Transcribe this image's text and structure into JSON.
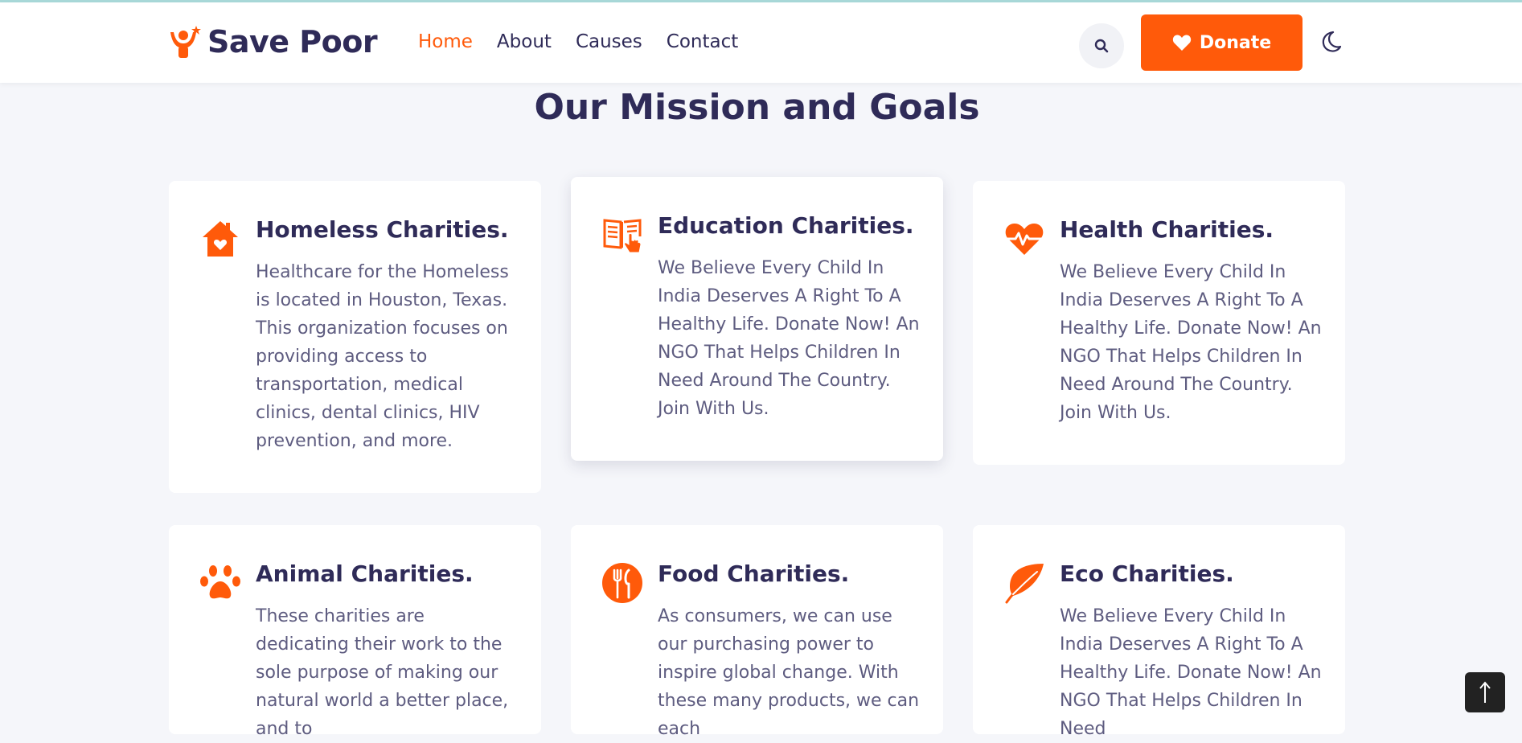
{
  "brand": {
    "name": "Save Poor",
    "accent": "#ff5a0a",
    "dark": "#2f2b58"
  },
  "nav": {
    "items": [
      {
        "label": "Home",
        "active": true
      },
      {
        "label": "About",
        "active": false
      },
      {
        "label": "Causes",
        "active": false
      },
      {
        "label": "Contact",
        "active": false
      }
    ]
  },
  "header": {
    "search_icon": "search-icon",
    "donate_label": "Donate",
    "donate_icon": "heart-icon",
    "theme_icon": "moon-icon"
  },
  "section": {
    "title": "Our Mission and Goals"
  },
  "cards": [
    {
      "title": "Homeless Charities.",
      "icon": "house-heart-icon",
      "text": "Healthcare for the Homeless is located in Houston, Texas. This organization focuses on providing access to transportation, medical clinics, dental clinics, HIV prevention, and more."
    },
    {
      "title": "Education Charities.",
      "icon": "book-hand-icon",
      "text": "We Believe Every Child In India Deserves A Right To A Healthy Life. Donate Now! An NGO That Helps Children In Need Around The Country. Join With Us."
    },
    {
      "title": "Health Charities.",
      "icon": "heartbeat-icon",
      "text": "We Believe Every Child In India Deserves A Right To A Healthy Life. Donate Now! An NGO That Helps Children In Need Around The Country. Join With Us."
    },
    {
      "title": "Animal Charities.",
      "icon": "paw-icon",
      "text": "These charities are dedicating their work to the sole purpose of making our natural world a better place, and to"
    },
    {
      "title": "Food Charities.",
      "icon": "fork-knife-icon",
      "text": "As consumers, we can use our purchasing power to inspire global change. With these many products, we can each"
    },
    {
      "title": "Eco Charities.",
      "icon": "leaf-icon",
      "text": "We Believe Every Child In India Deserves A Right To A Healthy Life. Donate Now! An NGO That Helps Children In Need"
    }
  ],
  "scroll_top_icon": "arrow-up-icon"
}
